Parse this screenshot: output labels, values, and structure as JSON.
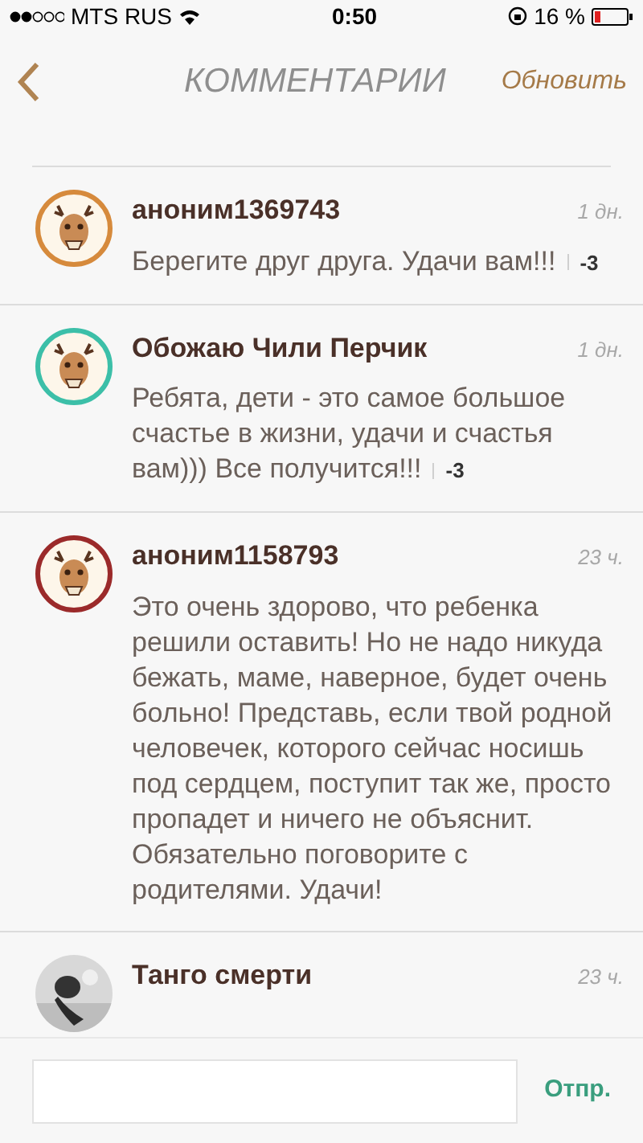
{
  "status_bar": {
    "carrier": "MTS RUS",
    "time": "0:50",
    "battery": "16 %"
  },
  "nav": {
    "title": "КОММЕНТАРИИ",
    "action": "Обновить"
  },
  "comments": [
    {
      "author": "аноним1369743",
      "time": "1 дн.",
      "text": "Берегите друг друга. Удачи вам!!!",
      "score": "-3",
      "kind": "deer",
      "color": "#d68a3c"
    },
    {
      "author": "Обожаю Чили Перчик",
      "time": "1 дн.",
      "text": "Ребята, дети - это самое большое счастье в жизни, удачи и счастья вам))) Все получится!!!",
      "score": "-3",
      "kind": "deer",
      "color": "#3cbfa8"
    },
    {
      "author": "аноним1158793",
      "time": "23 ч.",
      "text": "Это очень здорово, что ребенка решили оставить! Но не надо никуда бежать, маме, наверное, будет очень больно! Представь, если твой родной человечек, которого сейчас носишь под сердцем, поступит так же, просто пропадет и ничего не объяснит. Обязательно поговорите с родителями. Удачи!",
      "kind": "deer",
      "color": "#9b2a2a"
    },
    {
      "author": "Танго смерти",
      "time": "23 ч.",
      "kind": "picture"
    }
  ],
  "composer": {
    "send": "Отпр."
  }
}
